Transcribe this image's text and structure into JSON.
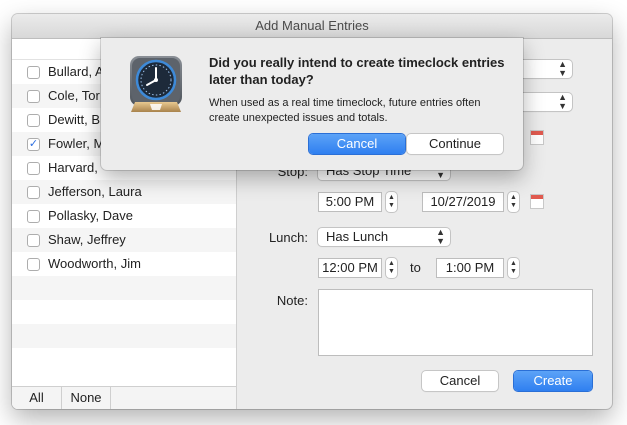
{
  "window": {
    "title": "Add Manual Entries"
  },
  "employees": [
    {
      "name": "Bullard, A",
      "checked": false
    },
    {
      "name": "Cole, Tor",
      "checked": false
    },
    {
      "name": "Dewitt, B",
      "checked": false
    },
    {
      "name": "Fowler, M",
      "checked": true
    },
    {
      "name": "Harvard, ",
      "checked": false
    },
    {
      "name": "Jefferson, Laura",
      "checked": false
    },
    {
      "name": "Pollasky, Dave",
      "checked": false
    },
    {
      "name": "Shaw, Jeffrey",
      "checked": false
    },
    {
      "name": "Woodworth, Jim",
      "checked": false
    }
  ],
  "list_footer": {
    "all_label": "All",
    "none_label": "None"
  },
  "form": {
    "stop_label": "Stop:",
    "stop_mode": "Has Stop Time",
    "stop_time": "5:00 PM",
    "stop_date": "10/27/2019",
    "lunch_label": "Lunch:",
    "lunch_mode": "Has Lunch",
    "lunch_start": "12:00 PM",
    "lunch_to": "to",
    "lunch_end": "1:00 PM",
    "note_label": "Note:",
    "note_value": "",
    "cancel_label": "Cancel",
    "create_label": "Create"
  },
  "alert": {
    "title": "Did you really intend to create timeclock entries later than today?",
    "message": "When used as a real time timeclock, future entries often create unexpected issues and totals.",
    "cancel_label": "Cancel",
    "continue_label": "Continue"
  },
  "icons": {
    "checkbox_check": "✓",
    "popup_chevron": "⌃⌄",
    "stepper": "⌃⌄"
  },
  "colors": {
    "accent_blue": "#2f7ff0",
    "calendar_red": "#e05a4f"
  }
}
